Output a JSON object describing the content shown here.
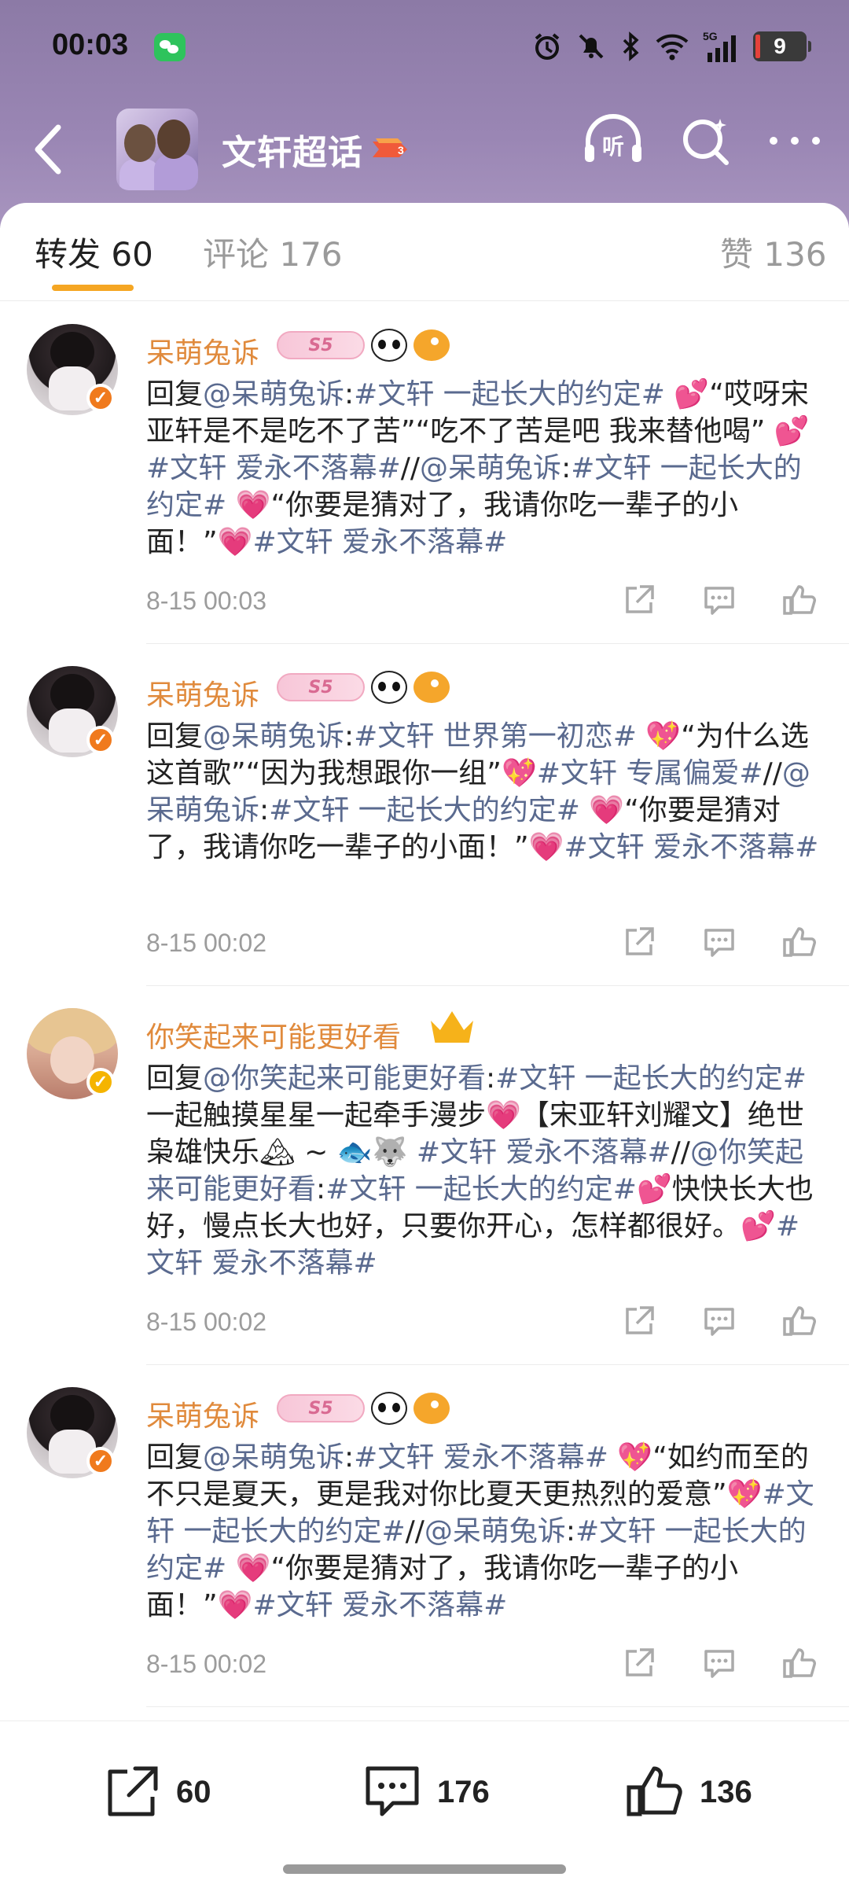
{
  "status_bar": {
    "time": "00:03",
    "battery": "9",
    "signal_label": "5G"
  },
  "header": {
    "title": "文轩超话"
  },
  "nav": {
    "listen_label": "听"
  },
  "tabs": {
    "repost": "转发 60",
    "comment": "评论 176",
    "like": "赞 136"
  },
  "posts": [
    {
      "username": "呆萌兔诉",
      "badge_text": "S5",
      "segments": [
        "回复",
        "@呆萌兔诉",
        ":",
        "#文轩 一起长大的约定#",
        " 💕",
        "“哎呀宋亚轩是不是吃不了苦”“吃不了苦是吧  我来替他喝” ",
        "💕",
        "#文轩 爱永不落幕#",
        "//",
        "@呆萌兔诉",
        ":",
        "#文轩 一起长大的约定#",
        " 💗",
        "“你要是猜对了，我请你吃一辈子的小面！”",
        "💗",
        "#文轩 爱永不落幕#"
      ],
      "date": "8-15 00:03"
    },
    {
      "username": "呆萌兔诉",
      "badge_text": "S5",
      "segments": [
        "回复",
        "@呆萌兔诉",
        ":",
        "#文轩 世界第一初恋#",
        " 💖",
        "“为什么选这首歌”“因为我想跟你一组”",
        "💖",
        "#文轩 专属偏爱#",
        "//",
        "@呆萌兔诉",
        ":",
        "#文轩 一起长大的约定#",
        " 💗",
        "“你要是猜对了，我请你吃一辈子的小面！”",
        "💗",
        "#文轩 爱永不落幕#"
      ],
      "date": "8-15 00:02"
    },
    {
      "username": "你笑起来可能更好看",
      "segments": [
        "回复",
        "@你笑起来可能更好看",
        ":",
        "#文轩 一起长大的约定#",
        " 一起触摸星星一起牵手漫步",
        "💗",
        "【宋亚轩刘耀文】绝世枭雄快乐",
        "🏔",
        " ~ ",
        "🐟🐺",
        " ",
        "#文轩 爱永不落幕#",
        "//",
        "@你笑起来可能更好看",
        ":",
        "#文轩 一起长大的约定#",
        "💕",
        "快快长大也好，慢点长大也好，只要你开心，怎样都很好。",
        "💕",
        "#文轩 爱永不落幕#"
      ],
      "date": "8-15 00:02"
    },
    {
      "username": "呆萌兔诉",
      "badge_text": "S5",
      "segments": [
        "回复",
        "@呆萌兔诉",
        ":",
        "#文轩 爱永不落幕#",
        " 💖",
        "“如约而至的不只是夏天，更是我对你比夏天更热烈的爱意”",
        "💖",
        "#文轩 一起长大的约定#",
        "//",
        "@呆萌兔诉",
        ":",
        "#文轩 一起长大的约定#",
        " 💗",
        "“你要是猜对了，我请你吃一辈子的小面！”",
        "💗",
        "#文轩 爱永不落幕#"
      ],
      "date": "8-15 00:02"
    }
  ],
  "bottom_bar": {
    "repost_count": "60",
    "comment_count": "176",
    "like_count": "136"
  },
  "colors": {
    "accent": "#f5a623",
    "username": "#e08a3c",
    "link": "#5a6a8f",
    "header_bg": "#9a86b4"
  },
  "icons": [
    "back-arrow-icon",
    "listen-icon",
    "super-topic-search-icon",
    "more-icon",
    "share-icon",
    "comment-icon",
    "like-icon",
    "verified-badge-icon"
  ]
}
